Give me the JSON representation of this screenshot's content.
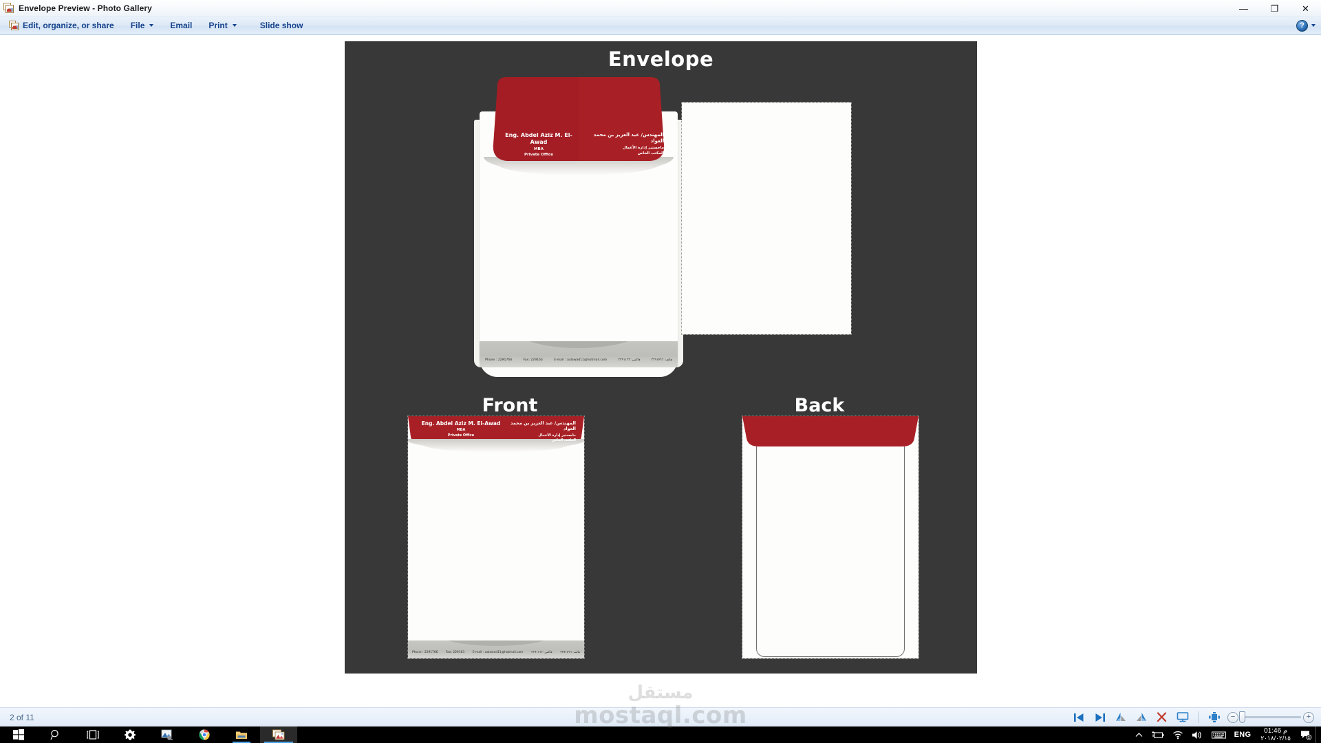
{
  "window": {
    "title": "Envelope Preview - Photo Gallery",
    "app_icon": "photo-gallery-icon",
    "controls": {
      "minimize": "—",
      "restore": "❐",
      "close": "✕"
    }
  },
  "toolbar": {
    "items": [
      {
        "label": "Edit, organize, or share",
        "icon": "photo-gallery-icon",
        "caret": false
      },
      {
        "label": "File",
        "icon": "",
        "caret": true
      },
      {
        "label": "Email",
        "icon": "",
        "caret": false
      },
      {
        "label": "Print",
        "icon": "",
        "caret": true
      },
      {
        "label": "Slide show",
        "icon": "",
        "caret": false
      }
    ],
    "help": {
      "label": "?",
      "icon": "help-icon",
      "caret": true
    }
  },
  "status_bar": {
    "page_indicator": "2 of 11",
    "controls": [
      {
        "name": "previous-image-button",
        "icon": "previous-icon",
        "label": "⏮"
      },
      {
        "name": "next-image-button",
        "icon": "next-icon",
        "label": "⏭"
      },
      {
        "name": "rotate-counterclockwise-button",
        "icon": "rotate-ccw-icon",
        "label": "↺"
      },
      {
        "name": "rotate-clockwise-button",
        "icon": "rotate-cw-icon",
        "label": "↻"
      },
      {
        "name": "delete-button",
        "icon": "delete-x-icon",
        "label": "✕"
      },
      {
        "name": "slideshow-button",
        "icon": "slideshow-icon",
        "label": "❐"
      },
      {
        "name": "fit-to-window-button",
        "icon": "fit-to-window-icon",
        "label": "⧉"
      }
    ],
    "zoom": {
      "out_label": "−",
      "in_label": "+",
      "value": 4
    }
  },
  "image": {
    "background_color": "#383838",
    "brand_red": "#a82025",
    "titles": {
      "main": "Envelope",
      "front": "Front",
      "back": "Back"
    },
    "letterhead": {
      "name_en": "Eng. Abdel Aziz M. El-Awad",
      "degree_en": "MBA",
      "office_en": "Private Office",
      "name_ar": "المهندس/ عبد العزيز بن محمد العواد",
      "degree_ar": "ماجستير إدارة الأعمال",
      "office_ar": "المكتب الخاص"
    },
    "contact": {
      "phone": "Phone : 2291766",
      "fax": "Fax: 229163",
      "email": "E-mail : aalawad11@hotmail.com",
      "fax_ar": "فاكس: ٢٢٩١١٦٣",
      "phone_ar": "هاتف: ٢٢٩١٧٦٦"
    }
  },
  "watermark": {
    "arabic": "مستقل",
    "domain": "mostaql.com"
  },
  "taskbar": {
    "buttons": [
      {
        "name": "start-button",
        "icon": "windows-logo-icon",
        "label": ""
      },
      {
        "name": "search-button",
        "icon": "search-icon",
        "label": ""
      },
      {
        "name": "task-view-button",
        "icon": "task-view-icon",
        "label": ""
      },
      {
        "name": "settings-button",
        "icon": "gear-icon",
        "label": ""
      },
      {
        "name": "photos-app-button",
        "icon": "photos-icon",
        "label": ""
      },
      {
        "name": "chrome-button",
        "icon": "chrome-icon",
        "label": ""
      },
      {
        "name": "file-explorer-button",
        "icon": "folder-icon",
        "label": ""
      },
      {
        "name": "photo-gallery-taskbar-button",
        "icon": "photo-gallery-icon",
        "label": ""
      }
    ],
    "tray": {
      "overflow": "∧",
      "battery": "battery-icon",
      "network": "wifi-icon",
      "volume": "speaker-icon",
      "keyboard": "keyboard-icon",
      "language": "ENG",
      "time": "01:46 م",
      "date": "٢٠١٨/٠٢/١٥",
      "action_center": "notification-icon"
    }
  }
}
